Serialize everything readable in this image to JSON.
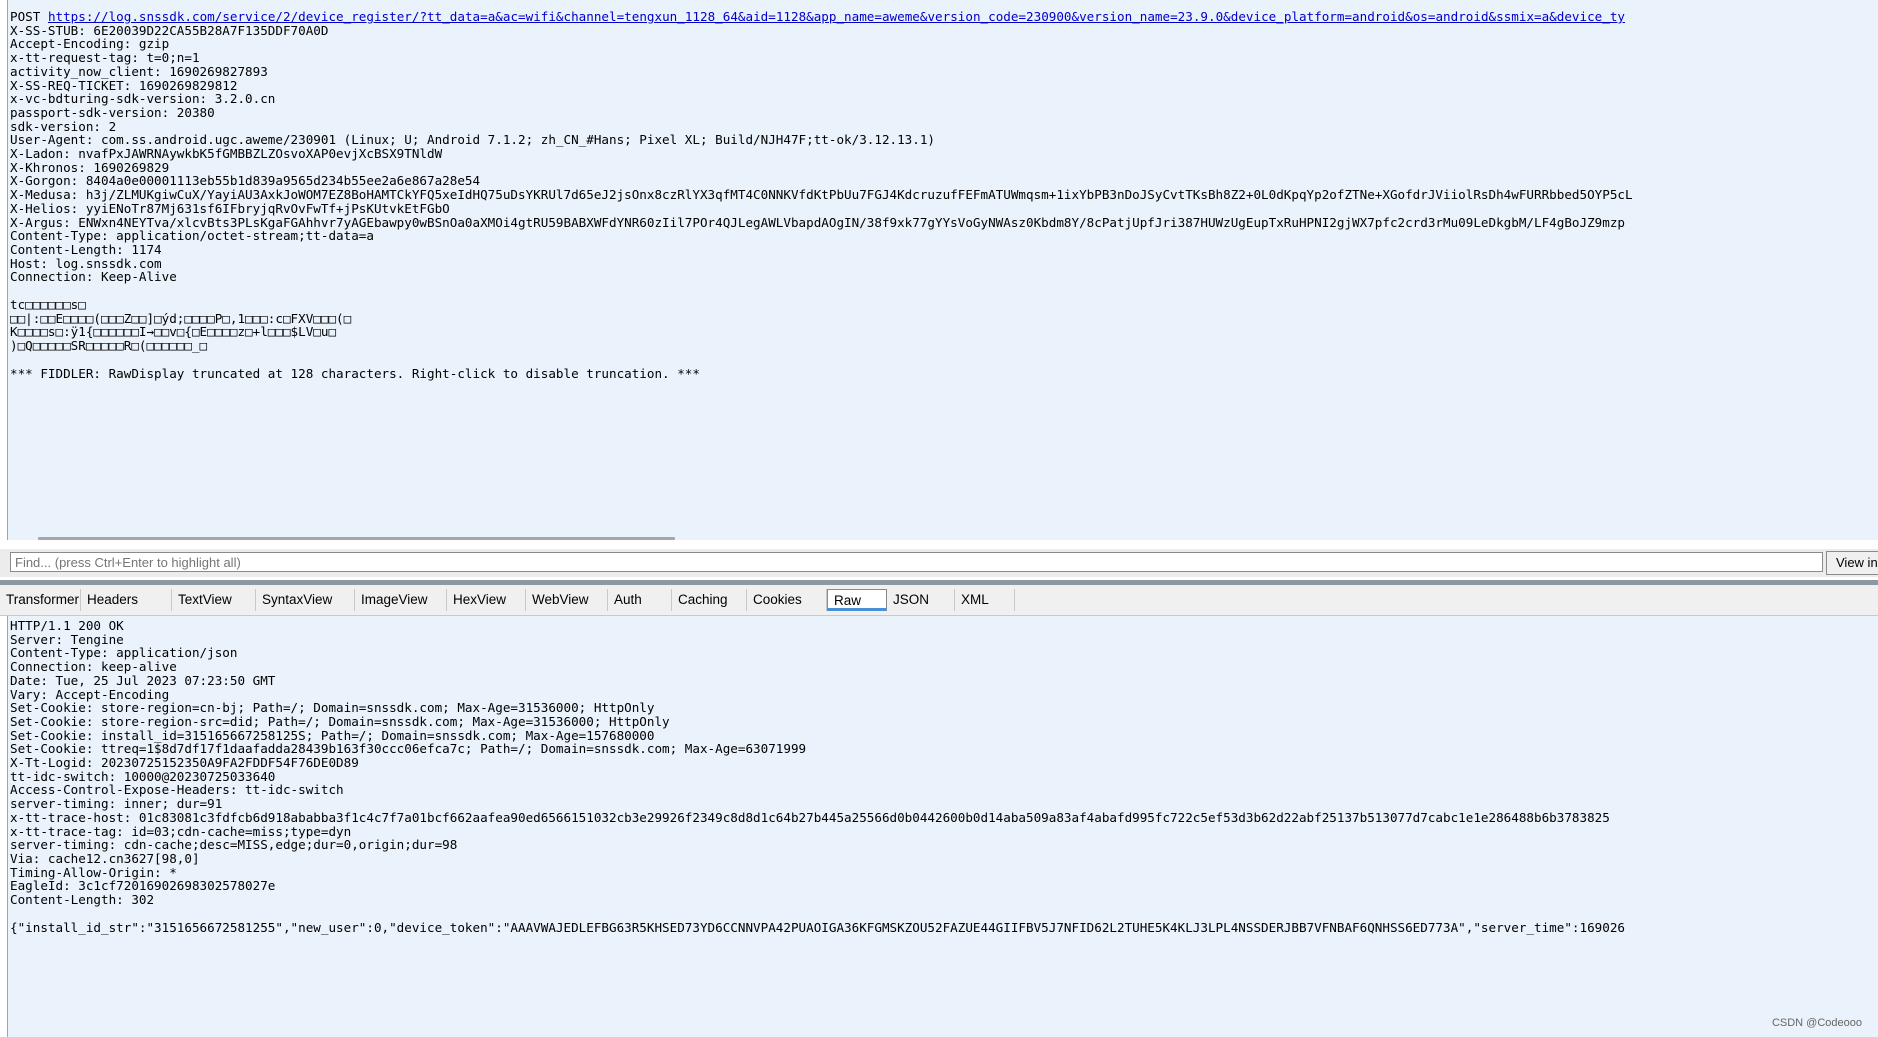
{
  "request": {
    "method": "POST",
    "url": "https://log.snssdk.com/service/2/device_register/?tt_data=a&ac=wifi&channel=tengxun_1128_64&aid=1128&app_name=aweme&version_code=230900&version_name=23.9.0&device_platform=android&os=android&ssmix=a&device_ty",
    "headers": [
      "X-SS-STUB: 6E20039D22CA55B28A7F135DDF70A0D",
      "Accept-Encoding: gzip",
      "x-tt-request-tag: t=0;n=1",
      "activity_now_client: 1690269827893",
      "X-SS-REQ-TICKET: 1690269829812",
      "x-vc-bdturing-sdk-version: 3.2.0.cn",
      "passport-sdk-version: 20380",
      "sdk-version: 2",
      "User-Agent: com.ss.android.ugc.aweme/230901 (Linux; U; Android 7.1.2; zh_CN_#Hans; Pixel XL; Build/NJH47F;tt-ok/3.12.13.1)",
      "X-Ladon: nvafPxJAWRNAywkbK5fGMBBZLZOsvoXAP0evjXcBSX9TNldW",
      "X-Khronos: 1690269829",
      "X-Gorgon: 8404a0e00001113eb55b1d839a9565d234b55ee2a6e867a28e54",
      "X-Medusa: h3j/ZLMUKgiwCuX/YayiAU3AxkJoWOM7EZ8BoHAMTCkYFQ5xeIdHQ75uDsYKRUl7d65eJ2jsOnx8czRlYX3qfMT4C0NNKVfdKtPbUu7FGJ4KdcruzufFEFmATUWmqsm+1ixYbPB3nDoJSyCvtTKsBh8Z2+0L0dKpqYp2ofZTNe+XGofdrJViiolRsDh4wFURRbbed5OYP5cL",
      "X-Helios: yyiENoTr87Mj631sf6IFbryjqRvOvFwTf+jPsKUtvkEtFGbO",
      "X-Argus: ENWxn4NEYTva/xlcvBts3PLsKgaFGAhhvr7yAGEbawpy0wBSnOa0aXMOi4gtRU59BABXWFdYNR60zIil7POr4QJLegAWLVbapdAOgIN/38f9xk77gYYsVoGyNWAsz0Kbdm8Y/8cPatjUpfJri387HUWzUgEupTxRuHPNI2gjWX7pfc2crd3rMu09LeDkgbM/LF4gBoJZ9mzp",
      "Content-Type: application/octet-stream;tt-data=a",
      "Content-Length: 1174",
      "Host: log.snssdk.com",
      "Connection: Keep-Alive"
    ],
    "body_lines": [
      "tc□□□□□□s□",
      "□□|:□□E□□□□(□□□Z□□]□ýd;□□□□P□,1□□□:c□FXV□□□(□",
      "K□□□□s□:ÿ1{□□□□□□I→□□v□{□E□□□□z□+l□□□$LV□u□",
      ")□Q□□□□□SR□□□□□R□(□□□□□□_□"
    ],
    "truncation_notice": "*** FIDDLER: RawDisplay truncated at 128 characters. Right-click to disable truncation. ***"
  },
  "find_bar": {
    "placeholder": "Find... (press Ctrl+Enter to highlight all)",
    "view_button_label": "View in"
  },
  "response_tabs": [
    {
      "label": "Transformer"
    },
    {
      "label": "Headers"
    },
    {
      "label": "TextView"
    },
    {
      "label": "SyntaxView"
    },
    {
      "label": "ImageView"
    },
    {
      "label": "HexView"
    },
    {
      "label": "WebView"
    },
    {
      "label": "Auth"
    },
    {
      "label": "Caching"
    },
    {
      "label": "Cookies"
    },
    {
      "label": "Raw"
    },
    {
      "label": "JSON"
    },
    {
      "label": "XML"
    }
  ],
  "active_tab": "Raw",
  "response": {
    "lines": [
      "HTTP/1.1 200 OK",
      "Server: Tengine",
      "Content-Type: application/json",
      "Connection: keep-alive",
      "Date: Tue, 25 Jul 2023 07:23:50 GMT",
      "Vary: Accept-Encoding",
      "Set-Cookie: store-region=cn-bj; Path=/; Domain=snssdk.com; Max-Age=31536000; HttpOnly",
      "Set-Cookie: store-region-src=did; Path=/; Domain=snssdk.com; Max-Age=31536000; HttpOnly",
      "Set-Cookie: install_id=315165667258125S; Path=/; Domain=snssdk.com; Max-Age=157680000",
      "Set-Cookie: ttreq=1$8d7df17f1daafadda28439b163f30ccc06efca7c; Path=/; Domain=snssdk.com; Max-Age=63071999",
      "X-Tt-Logid: 20230725152350A9FA2FDDF54F76DE0D89",
      "tt-idc-switch: 10000@20230725033640",
      "Access-Control-Expose-Headers: tt-idc-switch",
      "server-timing: inner; dur=91",
      "x-tt-trace-host: 01c83081c3fdfcb6d918ababba3f1c4c7f7a01bcf662aafea90ed6566151032cb3e29926f2349c8d8d1c64b27b445a25566d0b0442600b0d14aba509a83af4abafd995fc722c5ef53d3b62d22abf25137b513077d7cabc1e1e286488b6b3783825",
      "x-tt-trace-tag: id=03;cdn-cache=miss;type=dyn",
      "server-timing: cdn-cache;desc=MISS,edge;dur=0,origin;dur=98",
      "Via: cache12.cn3627[98,0]",
      "Timing-Allow-Origin: *",
      "EagleId: 3c1cf72016902698302578027e",
      "Content-Length: 302"
    ],
    "body": "{\"install_id_str\":\"3151656672581255\",\"new_user\":0,\"device_token\":\"AAAVWAJEDLEFBG63R5KHSED73YD6CCNNVPA42PUAOIGA36KFGMSKZOU52FAZUE44GIIFBV5J7NFID62L2TUHE5K4KLJ3LPL4NSSDERJBB7VFNBAF6QNHSS6ED773A\",\"server_time\":169026"
  },
  "watermark": "CSDN @Codeooo",
  "colors": {
    "pane_background": "#eaf2fb",
    "link": "#0000cc",
    "active_tab_underline": "#4a90d9"
  }
}
